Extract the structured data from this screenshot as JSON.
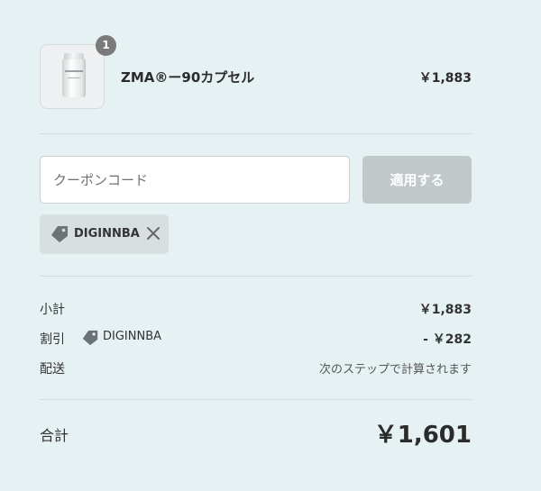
{
  "product": {
    "quantity": "1",
    "name": "ZMA®ー90カプセル",
    "price": "￥1,883"
  },
  "coupon": {
    "placeholder": "クーポンコード",
    "apply_label": "適用する",
    "applied_code": "DIGINNBA"
  },
  "summary": {
    "subtotal_label": "小計",
    "subtotal_value": "￥1,883",
    "discount_label": "割引",
    "discount_code": "DIGINNBA",
    "discount_value": "- ￥282",
    "shipping_label": "配送",
    "shipping_value": "次のステップで計算されます",
    "total_label": "合計",
    "total_value": "￥1,601"
  },
  "colors": {
    "background": "#e6f1f4",
    "apply_button": "#c1c8ca",
    "tag_background": "#d8dfe1",
    "badge": "#7a7a7a"
  },
  "icons": {
    "tag": "tag-icon",
    "close": "close-icon"
  }
}
